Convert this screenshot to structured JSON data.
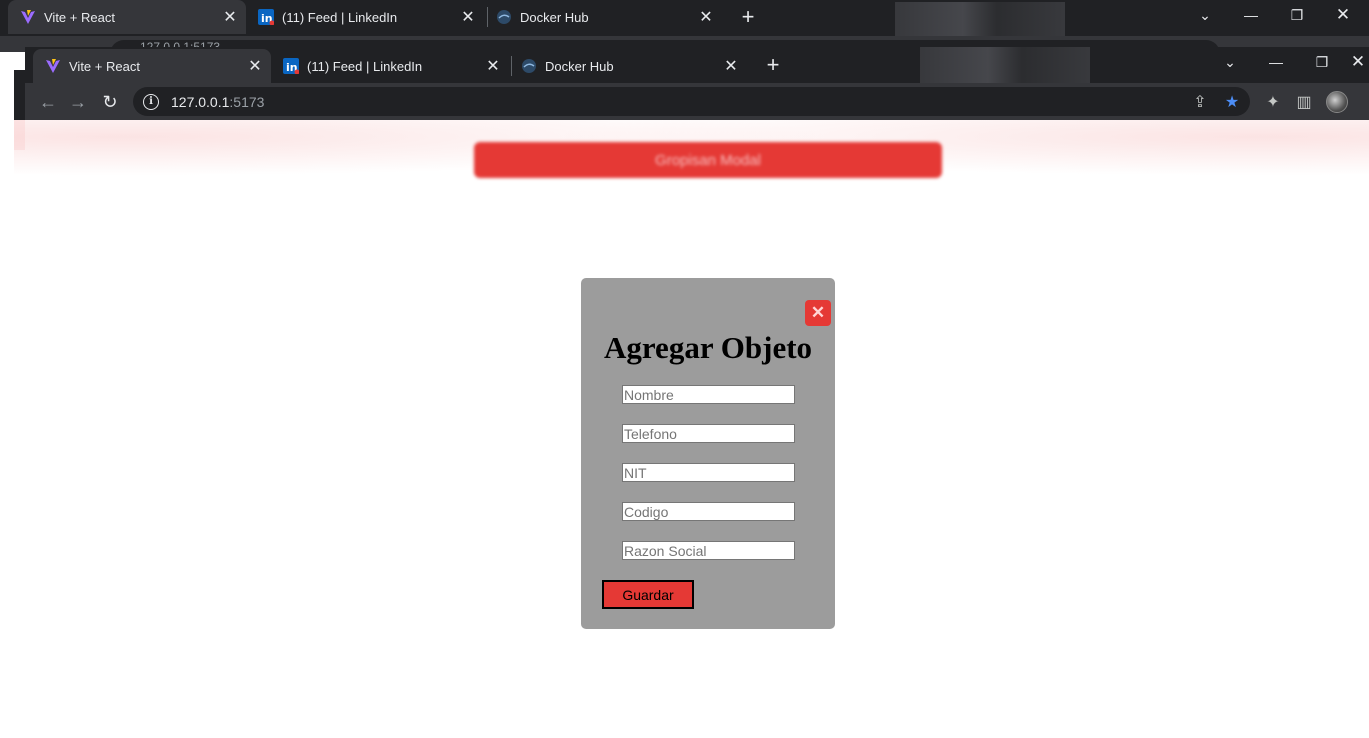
{
  "outer_browser": {
    "tabs": [
      {
        "title": "Vite + React",
        "active": true,
        "favicon": "vite-icon"
      },
      {
        "title": "(11) Feed | LinkedIn",
        "active": false,
        "favicon": "linkedin-icon"
      },
      {
        "title": "Docker Hub",
        "active": false,
        "favicon": "docker-icon"
      }
    ],
    "url_fragment": "127.0.0.1:5173",
    "new_tab": "+"
  },
  "browser": {
    "tabs": [
      {
        "title": "Vite + React",
        "active": true,
        "favicon": "vite-icon"
      },
      {
        "title": "(11) Feed | LinkedIn",
        "active": false,
        "favicon": "linkedin-icon"
      },
      {
        "title": "Docker Hub",
        "active": false,
        "favicon": "docker-icon"
      }
    ],
    "url_host": "127.0.0.1",
    "url_port": ":5173",
    "new_tab": "+",
    "bookmark_star_color": "#4c8df6"
  },
  "page": {
    "open_modal_label": "Gropisan Modal",
    "accent_color": "#e53935"
  },
  "modal": {
    "close_symbol": "✕",
    "title": "Agregar Objeto",
    "fields": [
      {
        "placeholder": "Nombre",
        "value": ""
      },
      {
        "placeholder": "Telefono",
        "value": ""
      },
      {
        "placeholder": "NIT",
        "value": ""
      },
      {
        "placeholder": "Codigo",
        "value": ""
      },
      {
        "placeholder": "Razon Social",
        "value": ""
      }
    ],
    "save_label": "Guardar",
    "background_color": "#9c9c9c"
  }
}
